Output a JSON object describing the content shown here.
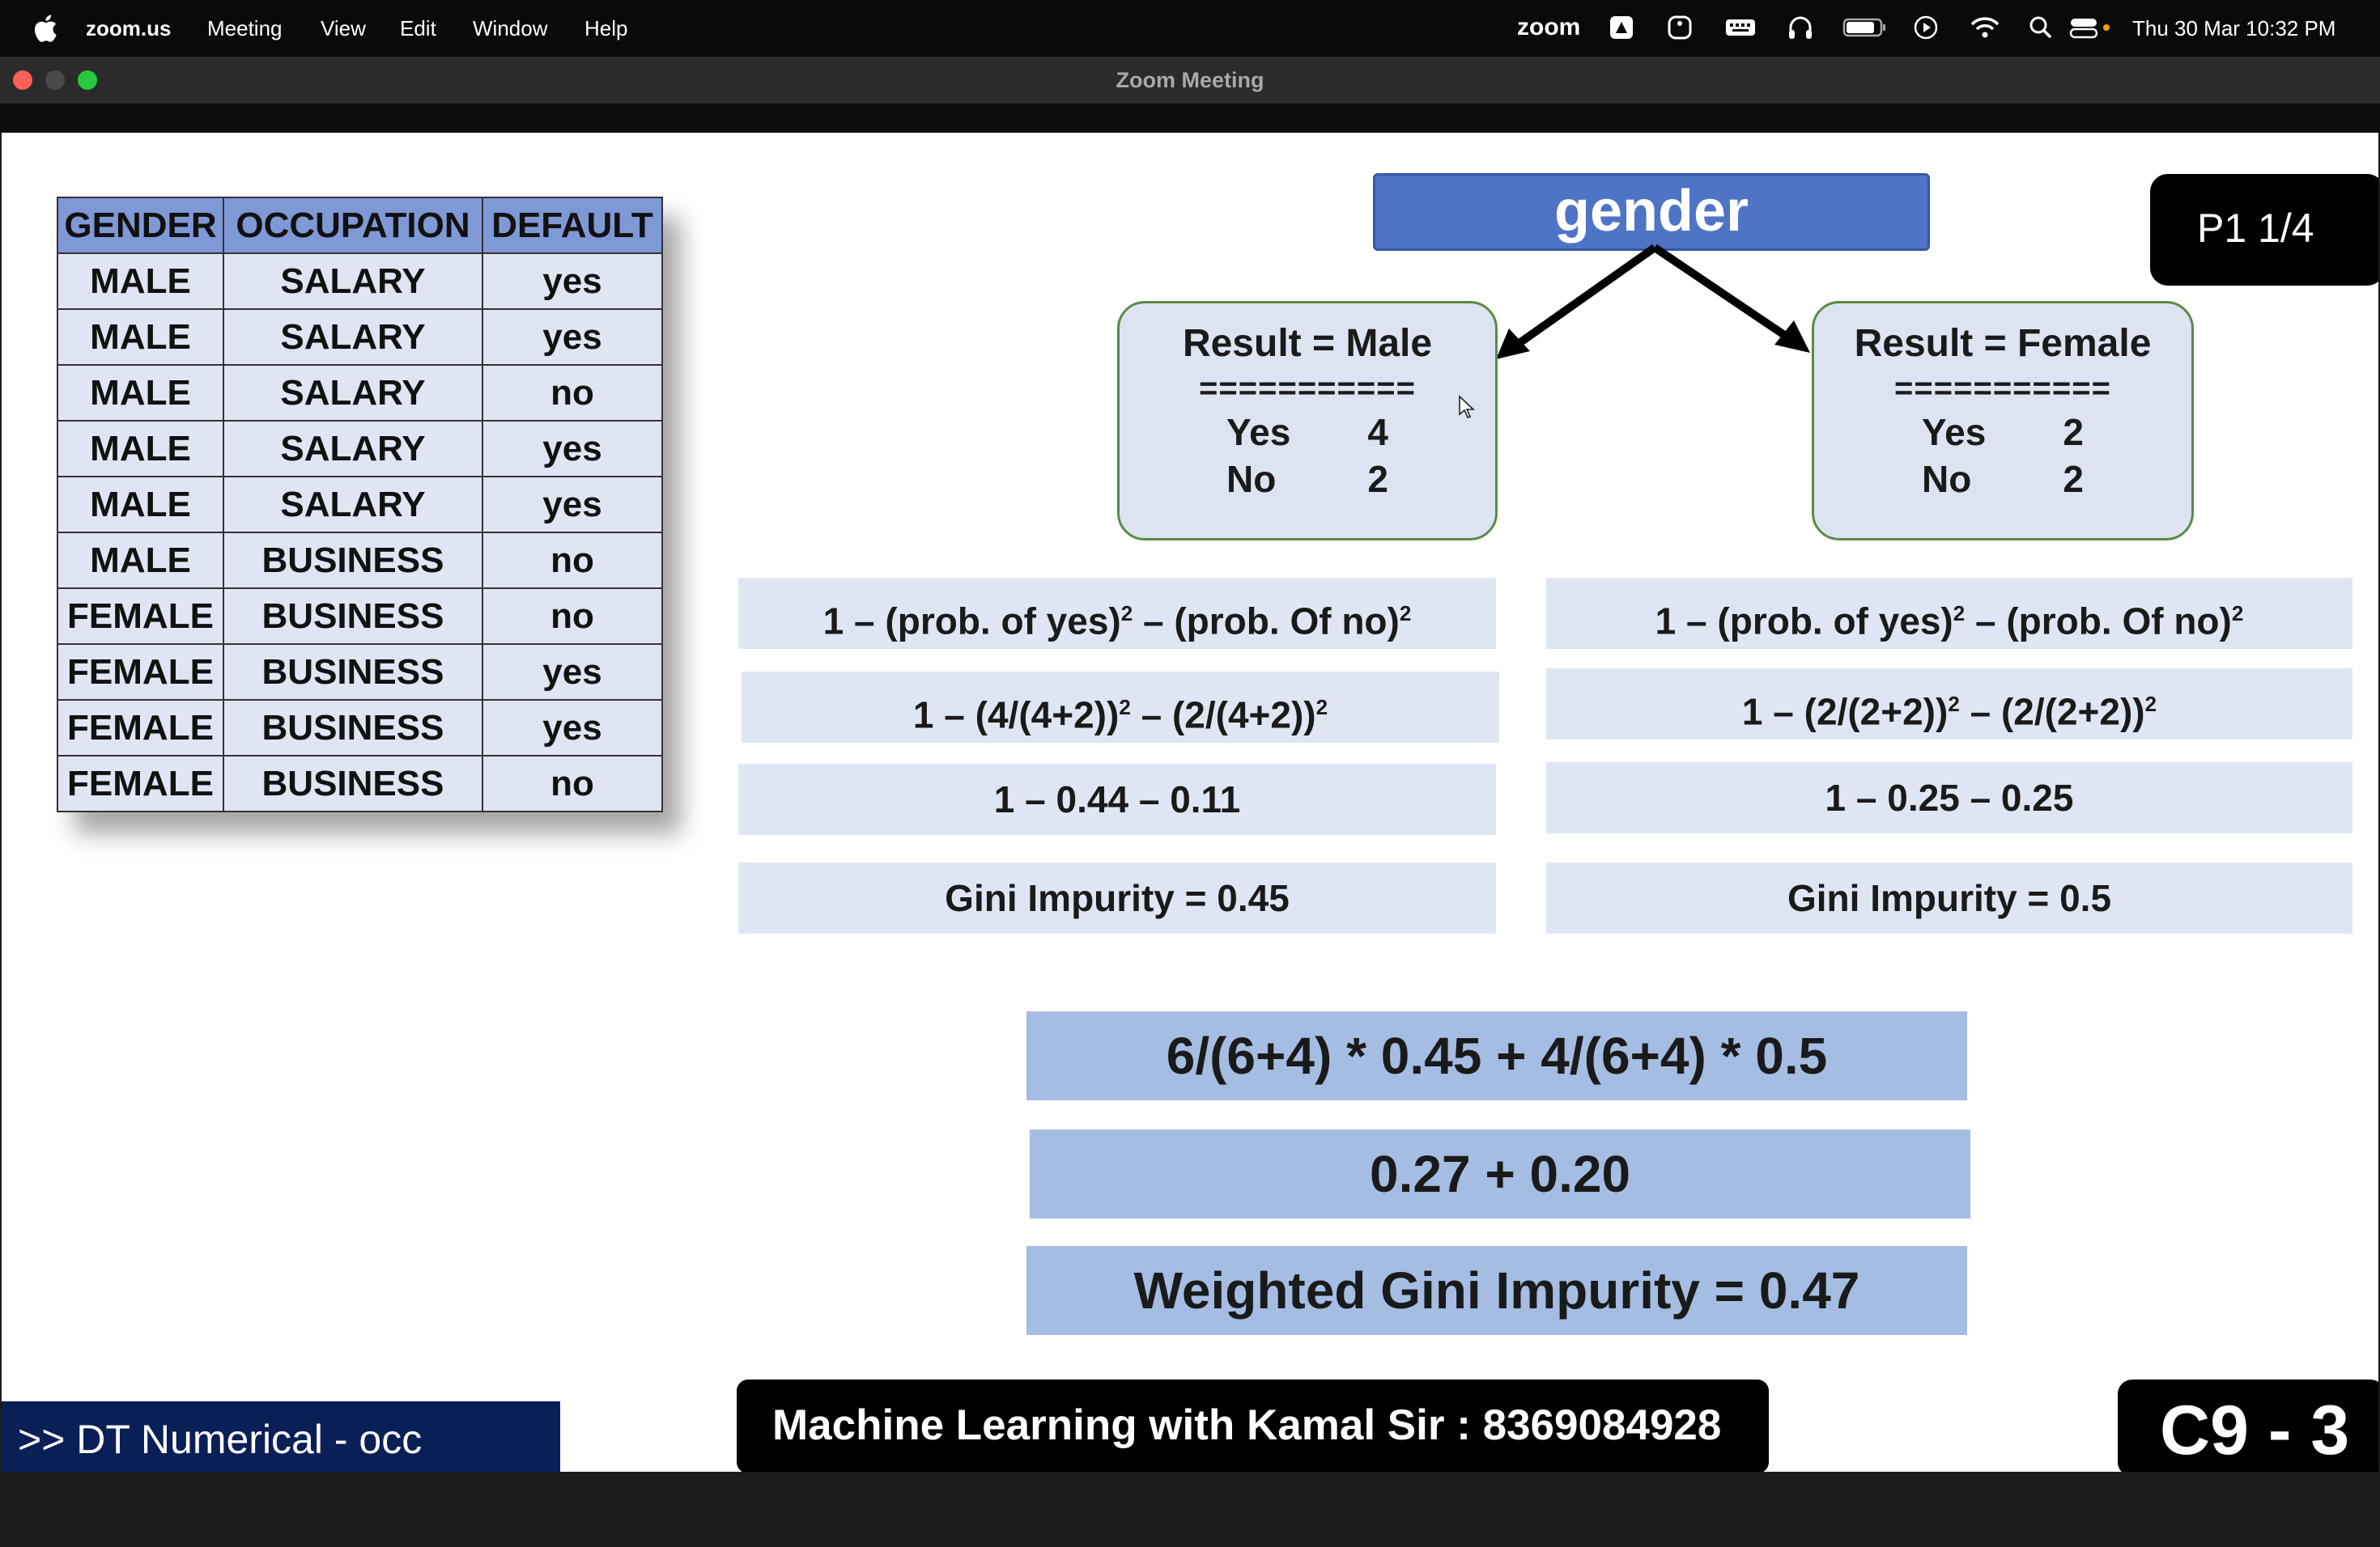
{
  "menubar": {
    "app": "zoom.us",
    "items": [
      "Meeting",
      "View",
      "Edit",
      "Window",
      "Help"
    ],
    "zoom_icon_label": "zoom",
    "clock": "Thu 30 Mar  10:32 PM"
  },
  "window": {
    "title": "Zoom Meeting"
  },
  "table": {
    "headers": [
      "GENDER",
      "OCCUPATION",
      "DEFAULT"
    ],
    "rows": [
      [
        "MALE",
        "SALARY",
        "yes"
      ],
      [
        "MALE",
        "SALARY",
        "yes"
      ],
      [
        "MALE",
        "SALARY",
        "no"
      ],
      [
        "MALE",
        "SALARY",
        "yes"
      ],
      [
        "MALE",
        "SALARY",
        "yes"
      ],
      [
        "MALE",
        "BUSINESS",
        "no"
      ],
      [
        "FEMALE",
        "BUSINESS",
        "no"
      ],
      [
        "FEMALE",
        "BUSINESS",
        "yes"
      ],
      [
        "FEMALE",
        "BUSINESS",
        "yes"
      ],
      [
        "FEMALE",
        "BUSINESS",
        "no"
      ]
    ]
  },
  "tree": {
    "root": "gender",
    "left": {
      "title": "Result = Male",
      "sep": "===========",
      "yes_label": "Yes",
      "yes": "4",
      "no_label": "No",
      "no": "2"
    },
    "right": {
      "title": "Result = Female",
      "sep": "===========",
      "yes_label": "Yes",
      "yes": "2",
      "no_label": "No",
      "no": "2"
    }
  },
  "left_calc": {
    "formula_a": "1 – (prob. of yes)",
    "formula_b": " – (prob. Of no)",
    "step1_a": "1 – (4/(4+2))",
    "step1_b": " – (2/(4+2))",
    "step2": "1 – 0.44 – 0.11",
    "result": "Gini Impurity = 0.45"
  },
  "right_calc": {
    "formula_a": "1 – (prob. of yes)",
    "formula_b": " – (prob. Of no)",
    "step1_a": "1 – (2/(2+2))",
    "step1_b": " – (2/(2+2))",
    "step2": "1 – 0.25 – 0.25",
    "result": "Gini Impurity = 0.5"
  },
  "sq": "2",
  "weighted": {
    "line1": "6/(6+4) * 0.45 + 4/(6+4) * 0.5",
    "line2": "0.27  +  0.20",
    "line3": "Weighted Gini Impurity = 0.47"
  },
  "page_indicator": "P1   1/4",
  "banner": "Machine Learning with Kamal Sir : 8369084928",
  "code": "C9 - 3",
  "topic_tag": ">>  DT Numerical - occ"
}
